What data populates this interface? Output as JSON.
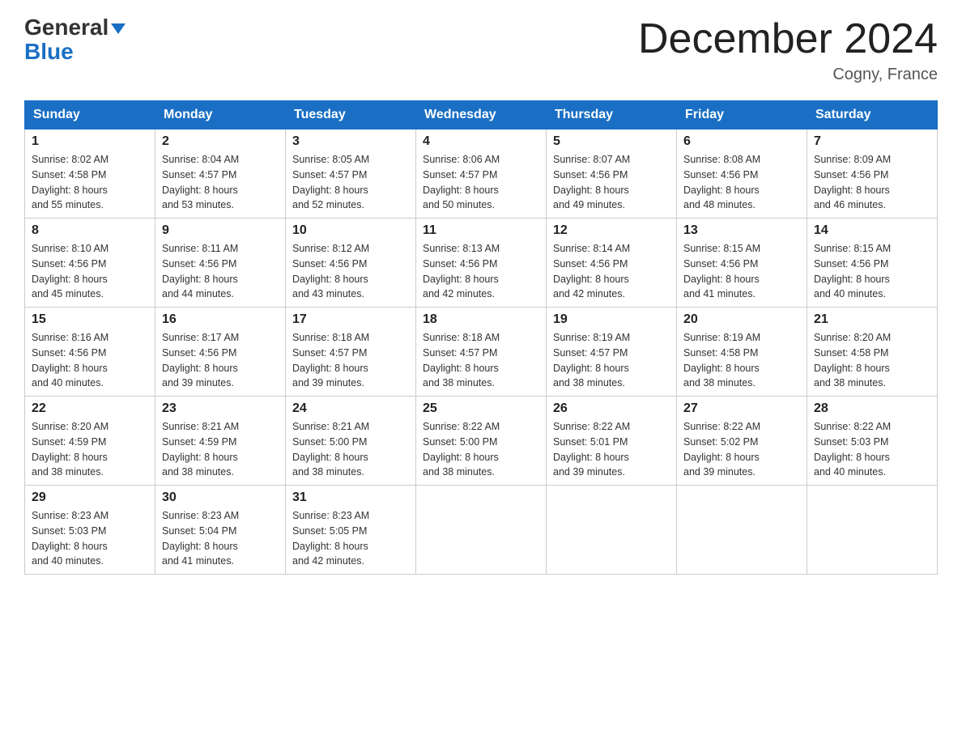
{
  "header": {
    "logo_line1": "General",
    "logo_line2": "Blue",
    "month_title": "December 2024",
    "location": "Cogny, France"
  },
  "days_of_week": [
    "Sunday",
    "Monday",
    "Tuesday",
    "Wednesday",
    "Thursday",
    "Friday",
    "Saturday"
  ],
  "weeks": [
    [
      {
        "day": "1",
        "sunrise": "8:02 AM",
        "sunset": "4:58 PM",
        "daylight": "8 hours and 55 minutes."
      },
      {
        "day": "2",
        "sunrise": "8:04 AM",
        "sunset": "4:57 PM",
        "daylight": "8 hours and 53 minutes."
      },
      {
        "day": "3",
        "sunrise": "8:05 AM",
        "sunset": "4:57 PM",
        "daylight": "8 hours and 52 minutes."
      },
      {
        "day": "4",
        "sunrise": "8:06 AM",
        "sunset": "4:57 PM",
        "daylight": "8 hours and 50 minutes."
      },
      {
        "day": "5",
        "sunrise": "8:07 AM",
        "sunset": "4:56 PM",
        "daylight": "8 hours and 49 minutes."
      },
      {
        "day": "6",
        "sunrise": "8:08 AM",
        "sunset": "4:56 PM",
        "daylight": "8 hours and 48 minutes."
      },
      {
        "day": "7",
        "sunrise": "8:09 AM",
        "sunset": "4:56 PM",
        "daylight": "8 hours and 46 minutes."
      }
    ],
    [
      {
        "day": "8",
        "sunrise": "8:10 AM",
        "sunset": "4:56 PM",
        "daylight": "8 hours and 45 minutes."
      },
      {
        "day": "9",
        "sunrise": "8:11 AM",
        "sunset": "4:56 PM",
        "daylight": "8 hours and 44 minutes."
      },
      {
        "day": "10",
        "sunrise": "8:12 AM",
        "sunset": "4:56 PM",
        "daylight": "8 hours and 43 minutes."
      },
      {
        "day": "11",
        "sunrise": "8:13 AM",
        "sunset": "4:56 PM",
        "daylight": "8 hours and 42 minutes."
      },
      {
        "day": "12",
        "sunrise": "8:14 AM",
        "sunset": "4:56 PM",
        "daylight": "8 hours and 42 minutes."
      },
      {
        "day": "13",
        "sunrise": "8:15 AM",
        "sunset": "4:56 PM",
        "daylight": "8 hours and 41 minutes."
      },
      {
        "day": "14",
        "sunrise": "8:15 AM",
        "sunset": "4:56 PM",
        "daylight": "8 hours and 40 minutes."
      }
    ],
    [
      {
        "day": "15",
        "sunrise": "8:16 AM",
        "sunset": "4:56 PM",
        "daylight": "8 hours and 40 minutes."
      },
      {
        "day": "16",
        "sunrise": "8:17 AM",
        "sunset": "4:56 PM",
        "daylight": "8 hours and 39 minutes."
      },
      {
        "day": "17",
        "sunrise": "8:18 AM",
        "sunset": "4:57 PM",
        "daylight": "8 hours and 39 minutes."
      },
      {
        "day": "18",
        "sunrise": "8:18 AM",
        "sunset": "4:57 PM",
        "daylight": "8 hours and 38 minutes."
      },
      {
        "day": "19",
        "sunrise": "8:19 AM",
        "sunset": "4:57 PM",
        "daylight": "8 hours and 38 minutes."
      },
      {
        "day": "20",
        "sunrise": "8:19 AM",
        "sunset": "4:58 PM",
        "daylight": "8 hours and 38 minutes."
      },
      {
        "day": "21",
        "sunrise": "8:20 AM",
        "sunset": "4:58 PM",
        "daylight": "8 hours and 38 minutes."
      }
    ],
    [
      {
        "day": "22",
        "sunrise": "8:20 AM",
        "sunset": "4:59 PM",
        "daylight": "8 hours and 38 minutes."
      },
      {
        "day": "23",
        "sunrise": "8:21 AM",
        "sunset": "4:59 PM",
        "daylight": "8 hours and 38 minutes."
      },
      {
        "day": "24",
        "sunrise": "8:21 AM",
        "sunset": "5:00 PM",
        "daylight": "8 hours and 38 minutes."
      },
      {
        "day": "25",
        "sunrise": "8:22 AM",
        "sunset": "5:00 PM",
        "daylight": "8 hours and 38 minutes."
      },
      {
        "day": "26",
        "sunrise": "8:22 AM",
        "sunset": "5:01 PM",
        "daylight": "8 hours and 39 minutes."
      },
      {
        "day": "27",
        "sunrise": "8:22 AM",
        "sunset": "5:02 PM",
        "daylight": "8 hours and 39 minutes."
      },
      {
        "day": "28",
        "sunrise": "8:22 AM",
        "sunset": "5:03 PM",
        "daylight": "8 hours and 40 minutes."
      }
    ],
    [
      {
        "day": "29",
        "sunrise": "8:23 AM",
        "sunset": "5:03 PM",
        "daylight": "8 hours and 40 minutes."
      },
      {
        "day": "30",
        "sunrise": "8:23 AM",
        "sunset": "5:04 PM",
        "daylight": "8 hours and 41 minutes."
      },
      {
        "day": "31",
        "sunrise": "8:23 AM",
        "sunset": "5:05 PM",
        "daylight": "8 hours and 42 minutes."
      },
      null,
      null,
      null,
      null
    ]
  ],
  "labels": {
    "sunrise": "Sunrise:",
    "sunset": "Sunset:",
    "daylight": "Daylight:"
  },
  "colors": {
    "header_bg": "#1a6fc4",
    "border": "#cccccc"
  }
}
